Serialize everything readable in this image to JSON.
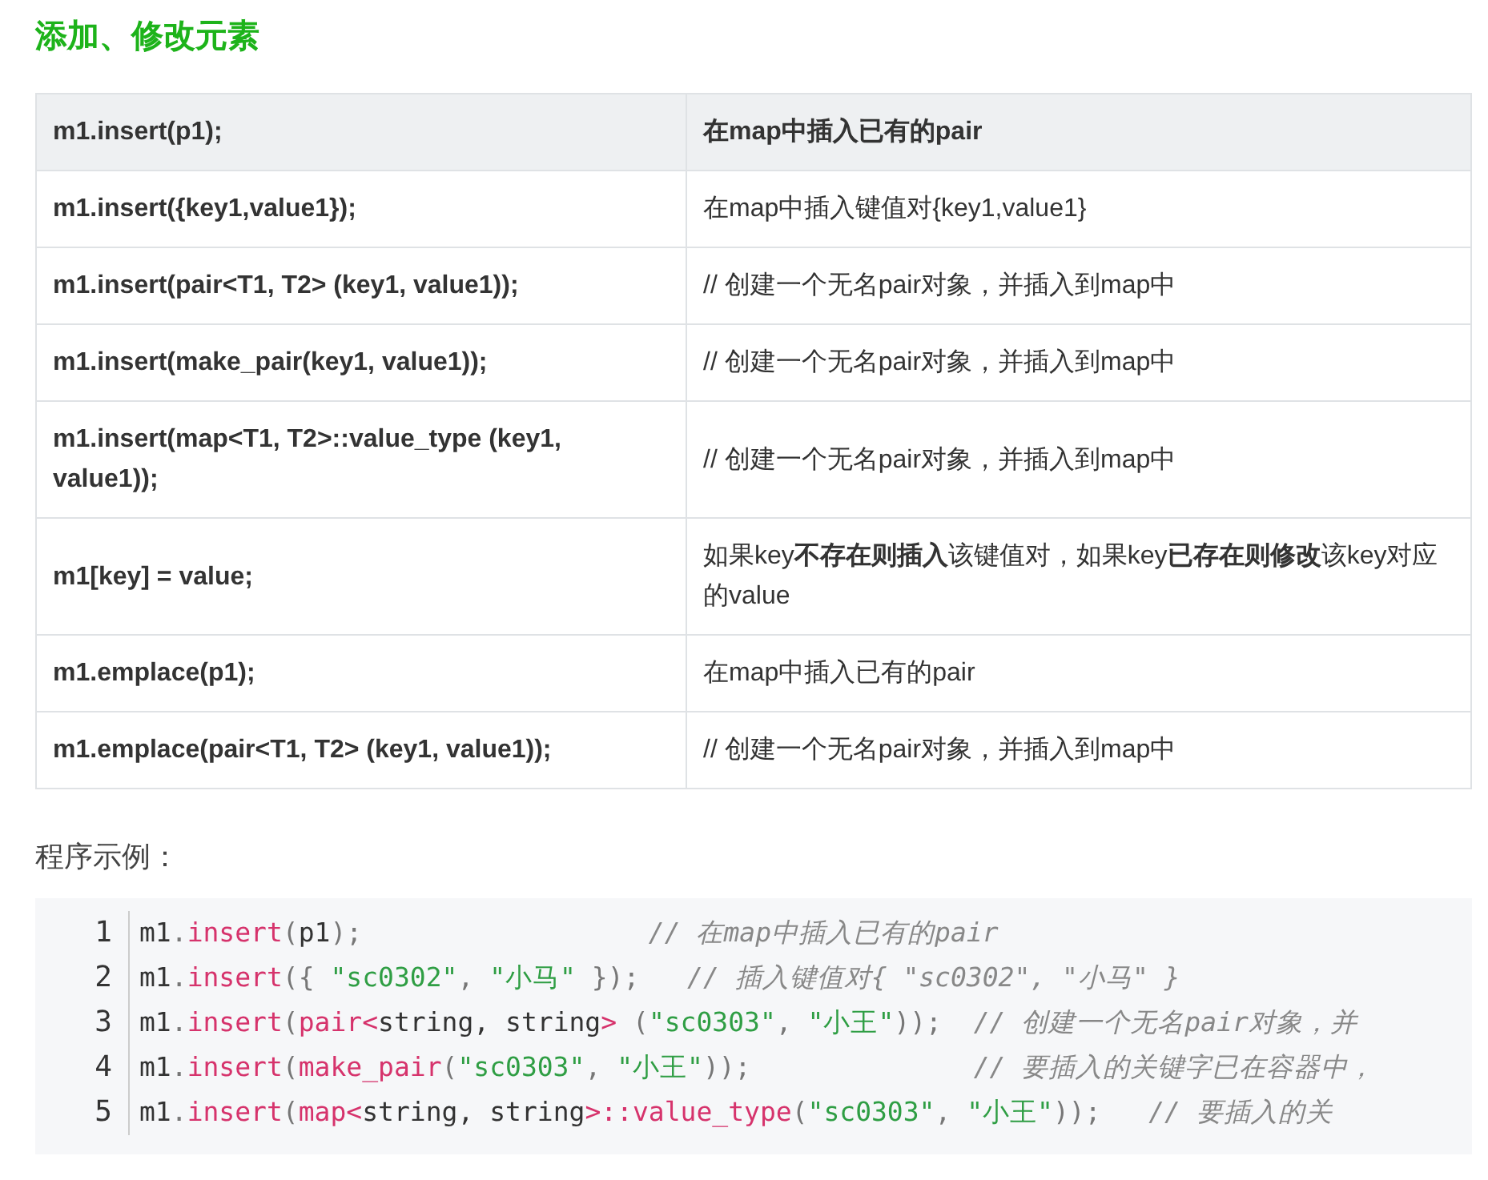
{
  "heading": "添加、修改元素",
  "table": {
    "header": {
      "code": "m1.insert(p1);",
      "desc": "在map中插入已有的pair"
    },
    "rows": [
      {
        "code": "m1.insert({key1,value1});",
        "desc": "在map中插入键值对{key1,value1}"
      },
      {
        "code": "m1.insert(pair<T1, T2> (key1, value1));",
        "desc": "// 创建一个无名pair对象，并插入到map中"
      },
      {
        "code": "m1.insert(make_pair(key1, value1));",
        "desc": "// 创建一个无名pair对象，并插入到map中"
      },
      {
        "code": "m1.insert(map<T1, T2>::value_type (key1, value1));",
        "desc": "// 创建一个无名pair对象，并插入到map中"
      },
      {
        "code": "m1[key] = value;",
        "desc": "如果key**不存在则插入**该键值对，如果key**已存在则修改**该key对应的value"
      },
      {
        "code": "m1.emplace(p1);",
        "desc": "在map中插入已有的pair"
      },
      {
        "code": "m1.emplace(pair<T1, T2> (key1, value1));",
        "desc": "// 创建一个无名pair对象，并插入到map中"
      }
    ]
  },
  "example_label": "程序示例：",
  "code": {
    "lines": [
      {
        "number": "1",
        "tokens": [
          {
            "kind": "plain",
            "text": "m1"
          },
          {
            "kind": "punct",
            "text": "."
          },
          {
            "kind": "fn",
            "text": "insert"
          },
          {
            "kind": "punct",
            "text": "("
          },
          {
            "kind": "plain",
            "text": "p1"
          },
          {
            "kind": "punct",
            "text": ");"
          },
          {
            "kind": "comment",
            "text": "                  // 在map中插入已有的pair"
          }
        ]
      },
      {
        "number": "2",
        "tokens": [
          {
            "kind": "plain",
            "text": "m1"
          },
          {
            "kind": "punct",
            "text": "."
          },
          {
            "kind": "fn",
            "text": "insert"
          },
          {
            "kind": "punct",
            "text": "({ "
          },
          {
            "kind": "str",
            "text": "\"sc0302\""
          },
          {
            "kind": "punct",
            "text": ", "
          },
          {
            "kind": "str",
            "text": "\"小马\""
          },
          {
            "kind": "punct",
            "text": " });"
          },
          {
            "kind": "comment",
            "text": "   // 插入键值对{ \"sc0302\", \"小马\" }"
          }
        ]
      },
      {
        "number": "3",
        "tokens": [
          {
            "kind": "plain",
            "text": "m1"
          },
          {
            "kind": "punct",
            "text": "."
          },
          {
            "kind": "fn",
            "text": "insert"
          },
          {
            "kind": "punct",
            "text": "("
          },
          {
            "kind": "fn",
            "text": "pair"
          },
          {
            "kind": "fn",
            "text": "<"
          },
          {
            "kind": "plain",
            "text": "string, string"
          },
          {
            "kind": "fn",
            "text": ">"
          },
          {
            "kind": "punct",
            "text": " ("
          },
          {
            "kind": "str",
            "text": "\"sc0303\""
          },
          {
            "kind": "punct",
            "text": ", "
          },
          {
            "kind": "str",
            "text": "\"小王\""
          },
          {
            "kind": "punct",
            "text": "));"
          },
          {
            "kind": "comment",
            "text": "  // 创建一个无名pair对象，并"
          }
        ]
      },
      {
        "number": "4",
        "tokens": [
          {
            "kind": "plain",
            "text": "m1"
          },
          {
            "kind": "punct",
            "text": "."
          },
          {
            "kind": "fn",
            "text": "insert"
          },
          {
            "kind": "punct",
            "text": "("
          },
          {
            "kind": "fn",
            "text": "make_pair"
          },
          {
            "kind": "punct",
            "text": "("
          },
          {
            "kind": "str",
            "text": "\"sc0303\""
          },
          {
            "kind": "punct",
            "text": ", "
          },
          {
            "kind": "str",
            "text": "\"小王\""
          },
          {
            "kind": "punct",
            "text": "));"
          },
          {
            "kind": "comment",
            "text": "              // 要插入的关键字已在容器中，"
          }
        ]
      },
      {
        "number": "5",
        "tokens": [
          {
            "kind": "plain",
            "text": "m1"
          },
          {
            "kind": "punct",
            "text": "."
          },
          {
            "kind": "fn",
            "text": "insert"
          },
          {
            "kind": "punct",
            "text": "("
          },
          {
            "kind": "fn",
            "text": "map"
          },
          {
            "kind": "fn",
            "text": "<"
          },
          {
            "kind": "plain",
            "text": "string, string"
          },
          {
            "kind": "fn",
            "text": ">::value_type"
          },
          {
            "kind": "punct",
            "text": "("
          },
          {
            "kind": "str",
            "text": "\"sc0303\""
          },
          {
            "kind": "punct",
            "text": ", "
          },
          {
            "kind": "str",
            "text": "\"小王\""
          },
          {
            "kind": "punct",
            "text": "));"
          },
          {
            "kind": "comment",
            "text": "   // 要插入的关"
          }
        ]
      }
    ]
  }
}
